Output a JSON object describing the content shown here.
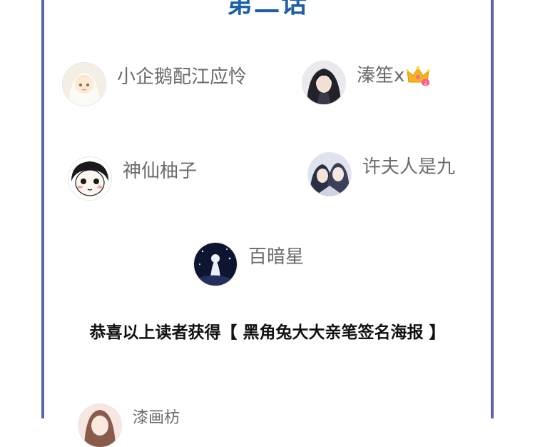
{
  "episode_title": "第二话",
  "readers": [
    {
      "name": "小企鹅配江应怜"
    },
    {
      "name": "溱笙x",
      "badge_icon": "crown-icon"
    },
    {
      "name": "神仙柚子"
    },
    {
      "name": "许夫人是九"
    },
    {
      "name": "百暗星"
    }
  ],
  "congrats_text": "恭喜以上读者获得【 黑角兔大大亲笔签名海报 】",
  "next_reader": {
    "name": "漆画枋"
  },
  "colors": {
    "frame_border": "#5a62a8",
    "title": "#1e5fa8",
    "name_text": "#6b6b6b",
    "crown": "#f5b41e"
  }
}
